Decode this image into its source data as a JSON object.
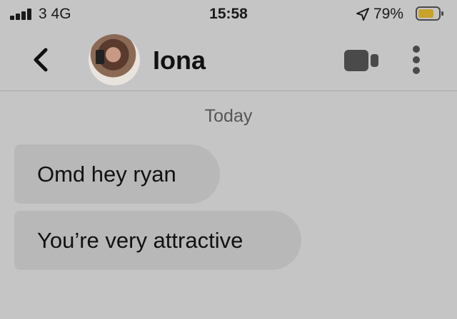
{
  "status_bar": {
    "carrier": "3  4G",
    "time": "15:58",
    "battery_percent": "79%",
    "signal_bars": 4,
    "battery_level": 0.79,
    "icons": [
      "signal-icon",
      "location-arrow-icon",
      "battery-icon"
    ]
  },
  "header": {
    "contact_name": "Iona",
    "icons": [
      "back-chevron-icon",
      "avatar",
      "video-call-icon",
      "more-vertical-icon"
    ]
  },
  "conversation": {
    "date_label": "Today",
    "messages": [
      {
        "text": "Omd hey ryan"
      },
      {
        "text": "You’re very attractive"
      }
    ]
  },
  "colors": {
    "background": "#c5c5c5",
    "bubble": "#b8b8b8",
    "battery_fill": "#c9a22a",
    "text": "#111111"
  }
}
